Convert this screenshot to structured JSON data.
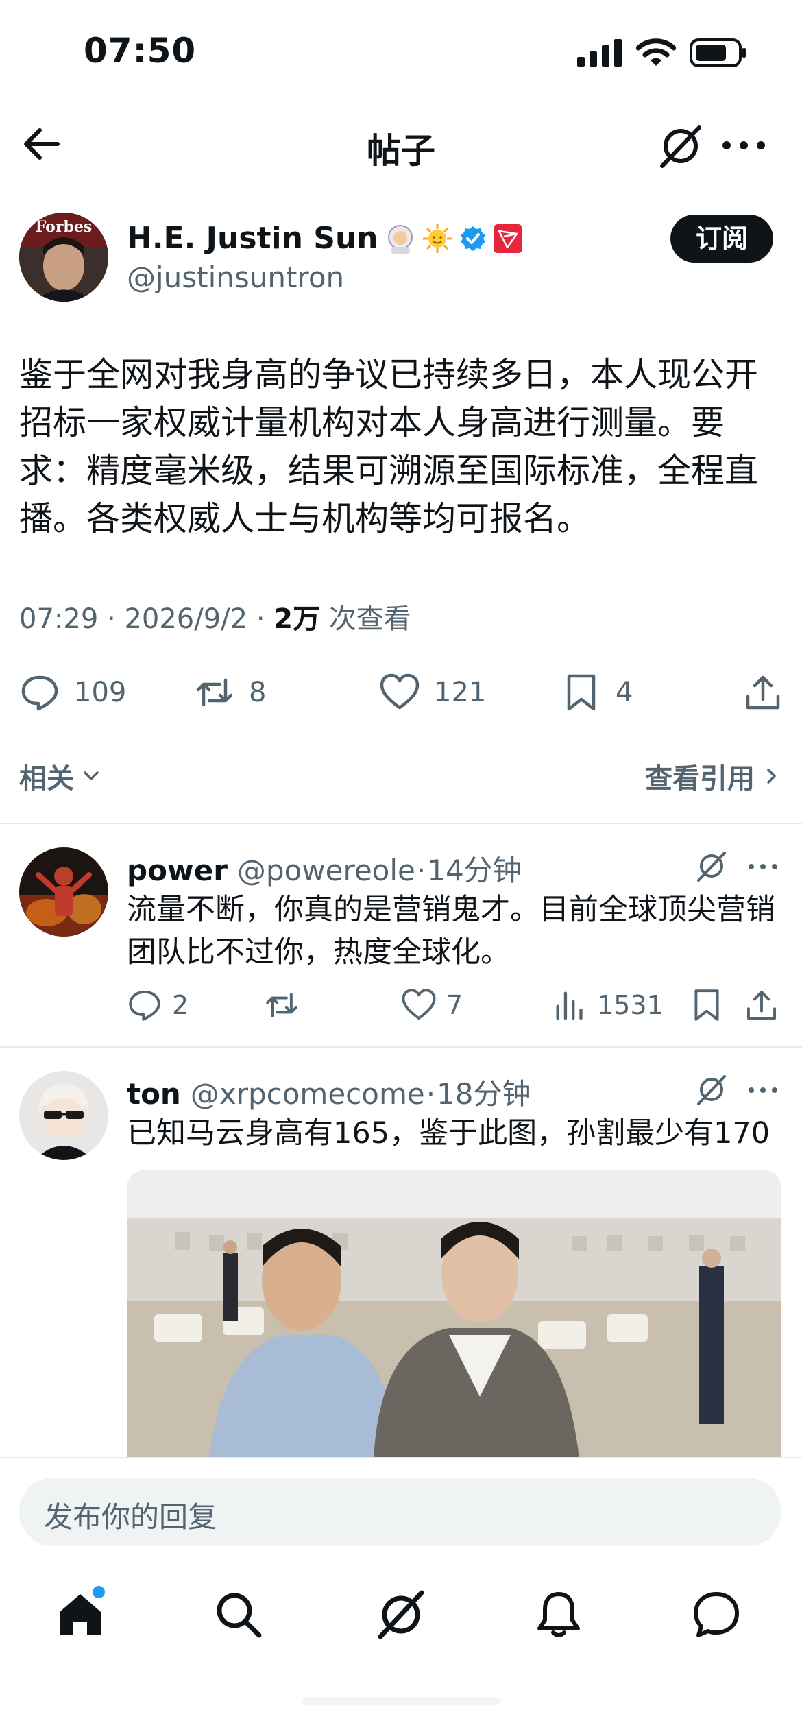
{
  "status_bar": {
    "time": "07:50"
  },
  "header": {
    "title": "帖子"
  },
  "post": {
    "author_name": "H.E. Justin Sun",
    "author_handle": "@justinsuntron",
    "avatar_badge": "Forbes",
    "subscribe_label": "订阅",
    "text": "鉴于全网对我身高的争议已持续多日，本人现公开招标一家权威计量机构对本人身高进行测量。要求：精度毫米级，结果可溯源至国际标准，全程直播。各类权威人士与机构等均可报名。",
    "time": "07:29",
    "date": "2026/9/2",
    "views_count": "2万",
    "views_label": "次查看",
    "stats": {
      "replies": "109",
      "reposts": "8",
      "likes": "121",
      "bookmarks": "4"
    },
    "related_label": "相关",
    "quotes_label": "查看引用"
  },
  "replies": [
    {
      "name": "power",
      "handle": "@powereole",
      "sep": "·",
      "age": "14分钟",
      "text": "流量不断，你真的是营销鬼才。目前全球顶尖营销团队比不过你，热度全球化。",
      "stats": {
        "replies": "2",
        "reposts": "",
        "likes": "7",
        "views": "1531"
      }
    },
    {
      "name": "ton",
      "handle": "@xrpcomecome",
      "sep": "·",
      "age": "18分钟",
      "text": "已知马云身高有165，鉴于此图，孙割最少有170"
    }
  ],
  "composer": {
    "placeholder": "发布你的回复"
  },
  "colors": {
    "text": "#0f1419",
    "secondary": "#536471",
    "accent": "#1d9bf0",
    "divider": "#e6e9ec",
    "tron_red": "#e8263b"
  }
}
